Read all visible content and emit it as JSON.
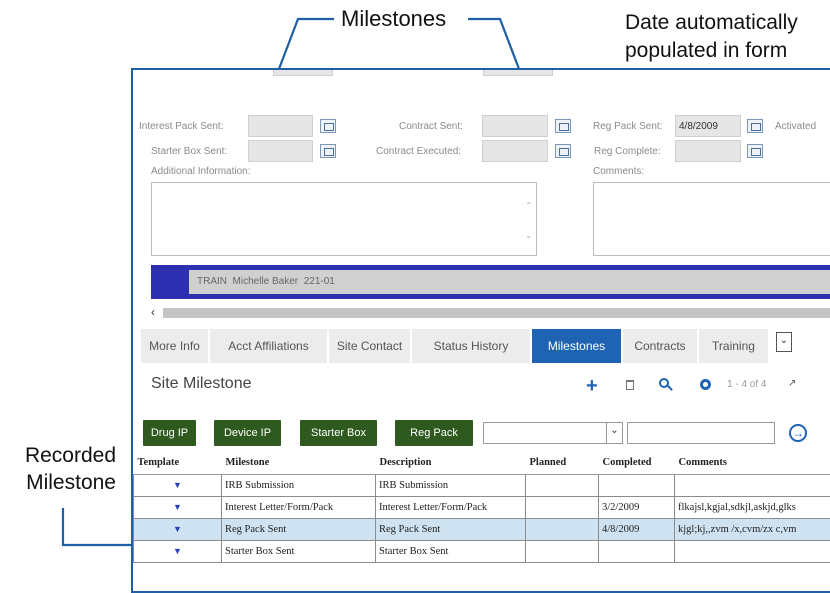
{
  "callouts": {
    "milestones": "Milestones",
    "date_auto": "Date automatically\npopulated in form",
    "recorded": "Recorded\nMilestone"
  },
  "form": {
    "interest_pack_sent": {
      "label": "Interest Pack Sent:",
      "value": ""
    },
    "contract_sent": {
      "label": "Contract Sent:",
      "value": ""
    },
    "reg_pack_sent": {
      "label": "Reg Pack Sent:",
      "value": "4/8/2009"
    },
    "activated": {
      "label": "Activated"
    },
    "starter_box_sent": {
      "label": "Starter Box Sent:",
      "value": ""
    },
    "contract_executed": {
      "label": "Contract Executed:",
      "value": ""
    },
    "reg_complete": {
      "label": "Reg Complete:",
      "value": ""
    },
    "additional_info": {
      "label": "Additional Information:"
    },
    "comments": {
      "label": "Comments:"
    }
  },
  "site_bar": {
    "text": "TRAIN  Michelle Baker  221-01"
  },
  "tabs": [
    {
      "label": "More Info"
    },
    {
      "label": "Acct Affiliations"
    },
    {
      "label": "Site Contact"
    },
    {
      "label": "Status History"
    },
    {
      "label": "Milestones",
      "active": true
    },
    {
      "label": "Contracts"
    },
    {
      "label": "Training"
    }
  ],
  "section": {
    "title": "Site Milestone",
    "pagination": "1 - 4 of 4"
  },
  "template_buttons": [
    {
      "label": "Drug IP"
    },
    {
      "label": "Device IP"
    },
    {
      "label": "Starter Box"
    },
    {
      "label": "Reg Pack"
    }
  ],
  "grid": {
    "columns": [
      "Template",
      "Milestone",
      "Description",
      "Planned",
      "Completed",
      "Comments"
    ],
    "rows": [
      {
        "milestone": "IRB Submission",
        "description": "IRB Submission",
        "planned": "",
        "completed": "",
        "comments": ""
      },
      {
        "milestone": "Interest Letter/Form/Pack",
        "description": "Interest Letter/Form/Pack",
        "planned": "",
        "completed": "3/2/2009",
        "comments": "flkajsl,kgjal,sdkjl,askjd,glks"
      },
      {
        "milestone": "Reg Pack Sent",
        "description": "Reg Pack Sent",
        "planned": "",
        "completed": "4/8/2009",
        "comments": "kjgl;kj,,zvm /x,cvm/zx c,vm"
      },
      {
        "milestone": "Starter Box Sent",
        "description": "Starter Box Sent",
        "planned": "",
        "completed": "",
        "comments": ""
      }
    ]
  },
  "colors": {
    "accent_blue": "#1f63b5",
    "site_bar": "#2b2fb0",
    "button_green": "#2f5a1f",
    "selected_row": "#cfe2f1",
    "callout_line": "#1f5fa6"
  },
  "icons": [
    "plus-icon",
    "trash-icon",
    "search-icon",
    "gear-icon",
    "expand-icon",
    "calendar-icon",
    "funnel-icon",
    "chevron-down-icon",
    "arrow-right-circle-icon",
    "chevron-left-icon"
  ]
}
